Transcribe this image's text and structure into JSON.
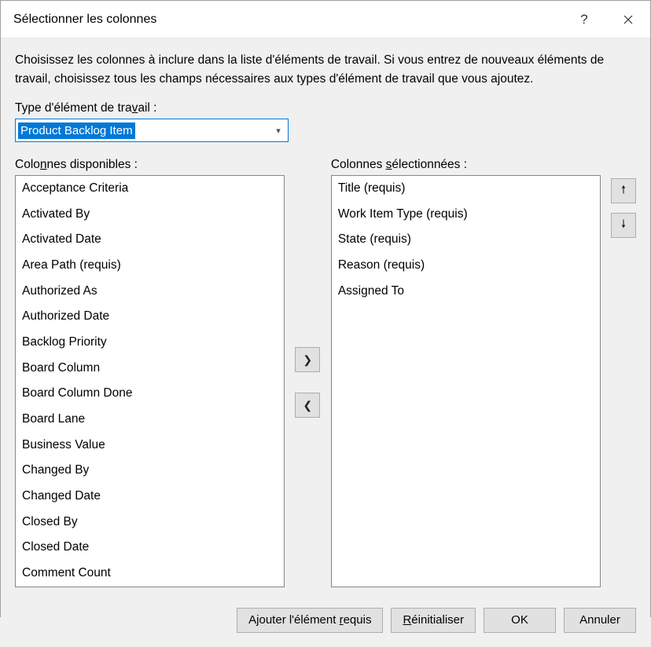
{
  "titlebar": {
    "title": "Sélectionner les colonnes"
  },
  "description": "Choisissez les colonnes à inclure dans la liste d'éléments de travail.  Si vous entrez de nouveaux éléments de travail, choisissez tous les champs nécessaires aux types d'élément de travail que vous ajoutez.",
  "typeLabel": {
    "pre": "Type d'élément de tra",
    "u": "v",
    "post": "ail :"
  },
  "typeCombo": {
    "value": "Product Backlog Item"
  },
  "availableLabel": {
    "pre": "Colo",
    "u": "n",
    "post": "nes disponibles :"
  },
  "selectedLabel": {
    "pre": "Colonnes ",
    "u": "s",
    "post": "électionnées :"
  },
  "available": [
    "Acceptance Criteria",
    "Activated By",
    "Activated Date",
    "Area Path (requis)",
    "Authorized As",
    "Authorized Date",
    "Backlog Priority",
    "Board Column",
    "Board Column Done",
    "Board Lane",
    "Business Value",
    "Changed By",
    "Changed Date",
    "Closed By",
    "Closed Date",
    "Comment Count"
  ],
  "selected": [
    "Title (requis)",
    "Work Item Type (requis)",
    "State (requis)",
    "Reason (requis)",
    "Assigned To"
  ],
  "buttons": {
    "addRequired": {
      "pre": "Ajouter l'élément ",
      "u": "r",
      "post": "equis"
    },
    "reset": {
      "pre": "",
      "u": "R",
      "post": "éinitialiser"
    },
    "ok": "OK",
    "cancel": "Annuler"
  }
}
